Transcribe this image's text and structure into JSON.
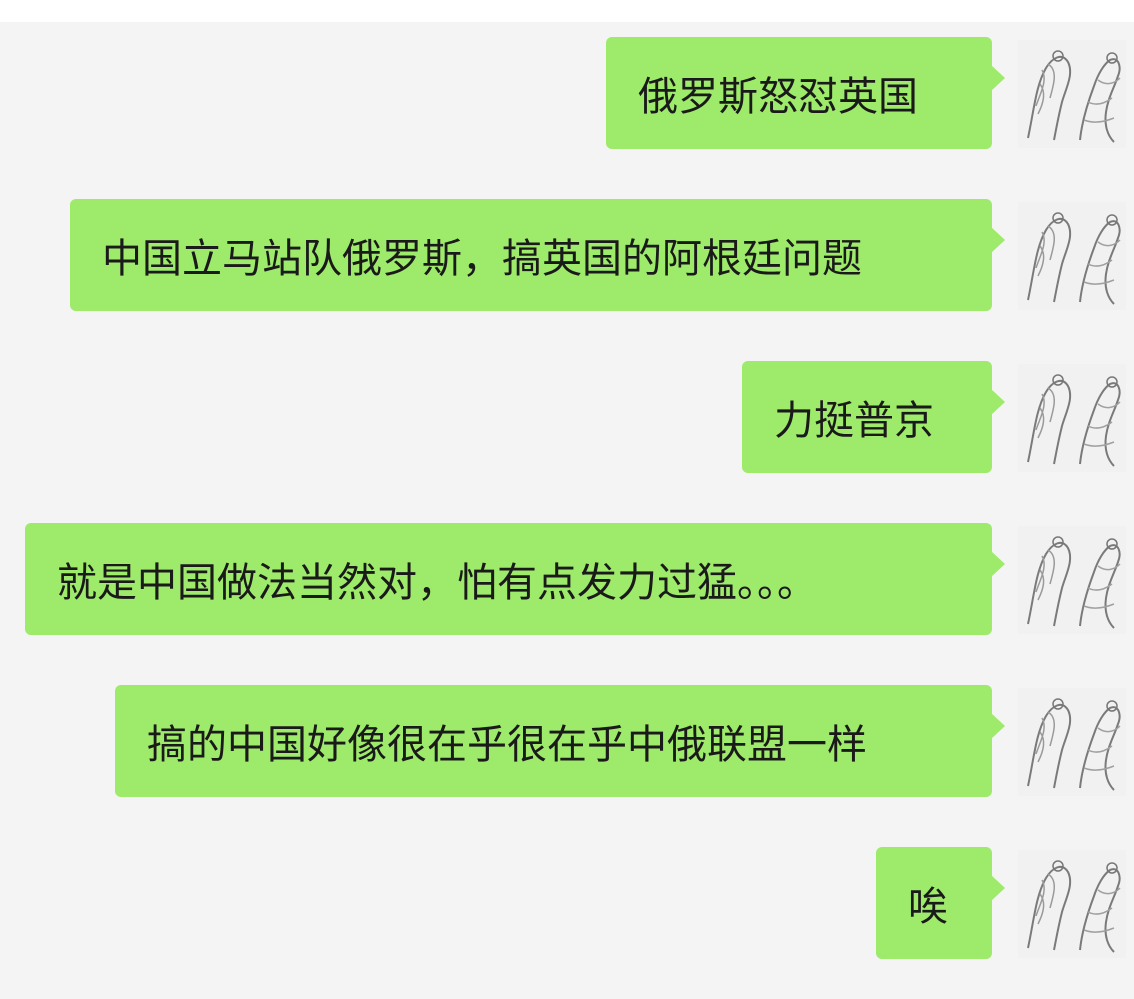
{
  "chat": {
    "messages": [
      {
        "text": "俄罗斯怒怼英国",
        "avatar_icon": "user-avatar-icon"
      },
      {
        "text": "中国立马站队俄罗斯，搞英国的阿根廷问题",
        "avatar_icon": "user-avatar-icon"
      },
      {
        "text": "力挺普京",
        "avatar_icon": "user-avatar-icon"
      },
      {
        "text": "就是中国做法当然对，怕有点发力过猛。。。",
        "avatar_icon": "user-avatar-icon"
      },
      {
        "text": "搞的中国好像很在乎很在乎中俄联盟一样",
        "avatar_icon": "user-avatar-icon"
      },
      {
        "text": "唉",
        "avatar_icon": "user-avatar-icon"
      }
    ]
  },
  "colors": {
    "bubble": "#9eea6a",
    "background": "#f4f4f4",
    "text": "#1a1a1a"
  }
}
